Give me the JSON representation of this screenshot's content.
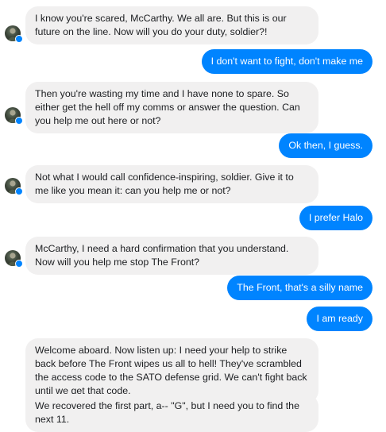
{
  "messages": [
    {
      "id": "m1",
      "from": "them",
      "text": "I know you're scared, McCarthy. We all are. But this is our future on the line. Now will you do your duty, soldier?!"
    },
    {
      "id": "m2",
      "from": "me",
      "text": "I don't want to fight, don't make me"
    },
    {
      "id": "m3",
      "from": "them",
      "text": "Then you're wasting my time and I have none to spare. So either get the hell off my comms or answer the question. Can you help me out here or not?"
    },
    {
      "id": "m4",
      "from": "me",
      "text": "Ok then, I guess."
    },
    {
      "id": "m5",
      "from": "them",
      "text": "Not what I would call confidence-inspiring, soldier. Give it to me like you mean it: can you help me or not?"
    },
    {
      "id": "m6",
      "from": "me",
      "text": "I prefer Halo"
    },
    {
      "id": "m7",
      "from": "them",
      "text": "McCarthy, I need a hard confirmation that you understand. Now will you help me stop The Front?"
    },
    {
      "id": "m8",
      "from": "me",
      "text": "The Front, that's a silly name"
    },
    {
      "id": "m9",
      "from": "me",
      "text": "I am ready"
    },
    {
      "id": "m10",
      "from": "them",
      "text": "Welcome aboard. Now listen up: I need your help to strike back before The Front wipes us all to hell! They've scrambled the access code to the SATO defense grid. We can't fight back until we get that code."
    },
    {
      "id": "m11",
      "from": "them",
      "text": "We recovered the first part, a-- \"G\", but I need you to find the next 11."
    }
  ],
  "colors": {
    "incoming_bubble": "#f1f0f0",
    "outgoing_bubble": "#0084ff",
    "incoming_text": "#1c1e21",
    "outgoing_text": "#ffffff",
    "badge": "#0084ff"
  },
  "icons": {
    "avatar": "soldier-avatar-icon",
    "badge": "messenger-badge-icon"
  }
}
